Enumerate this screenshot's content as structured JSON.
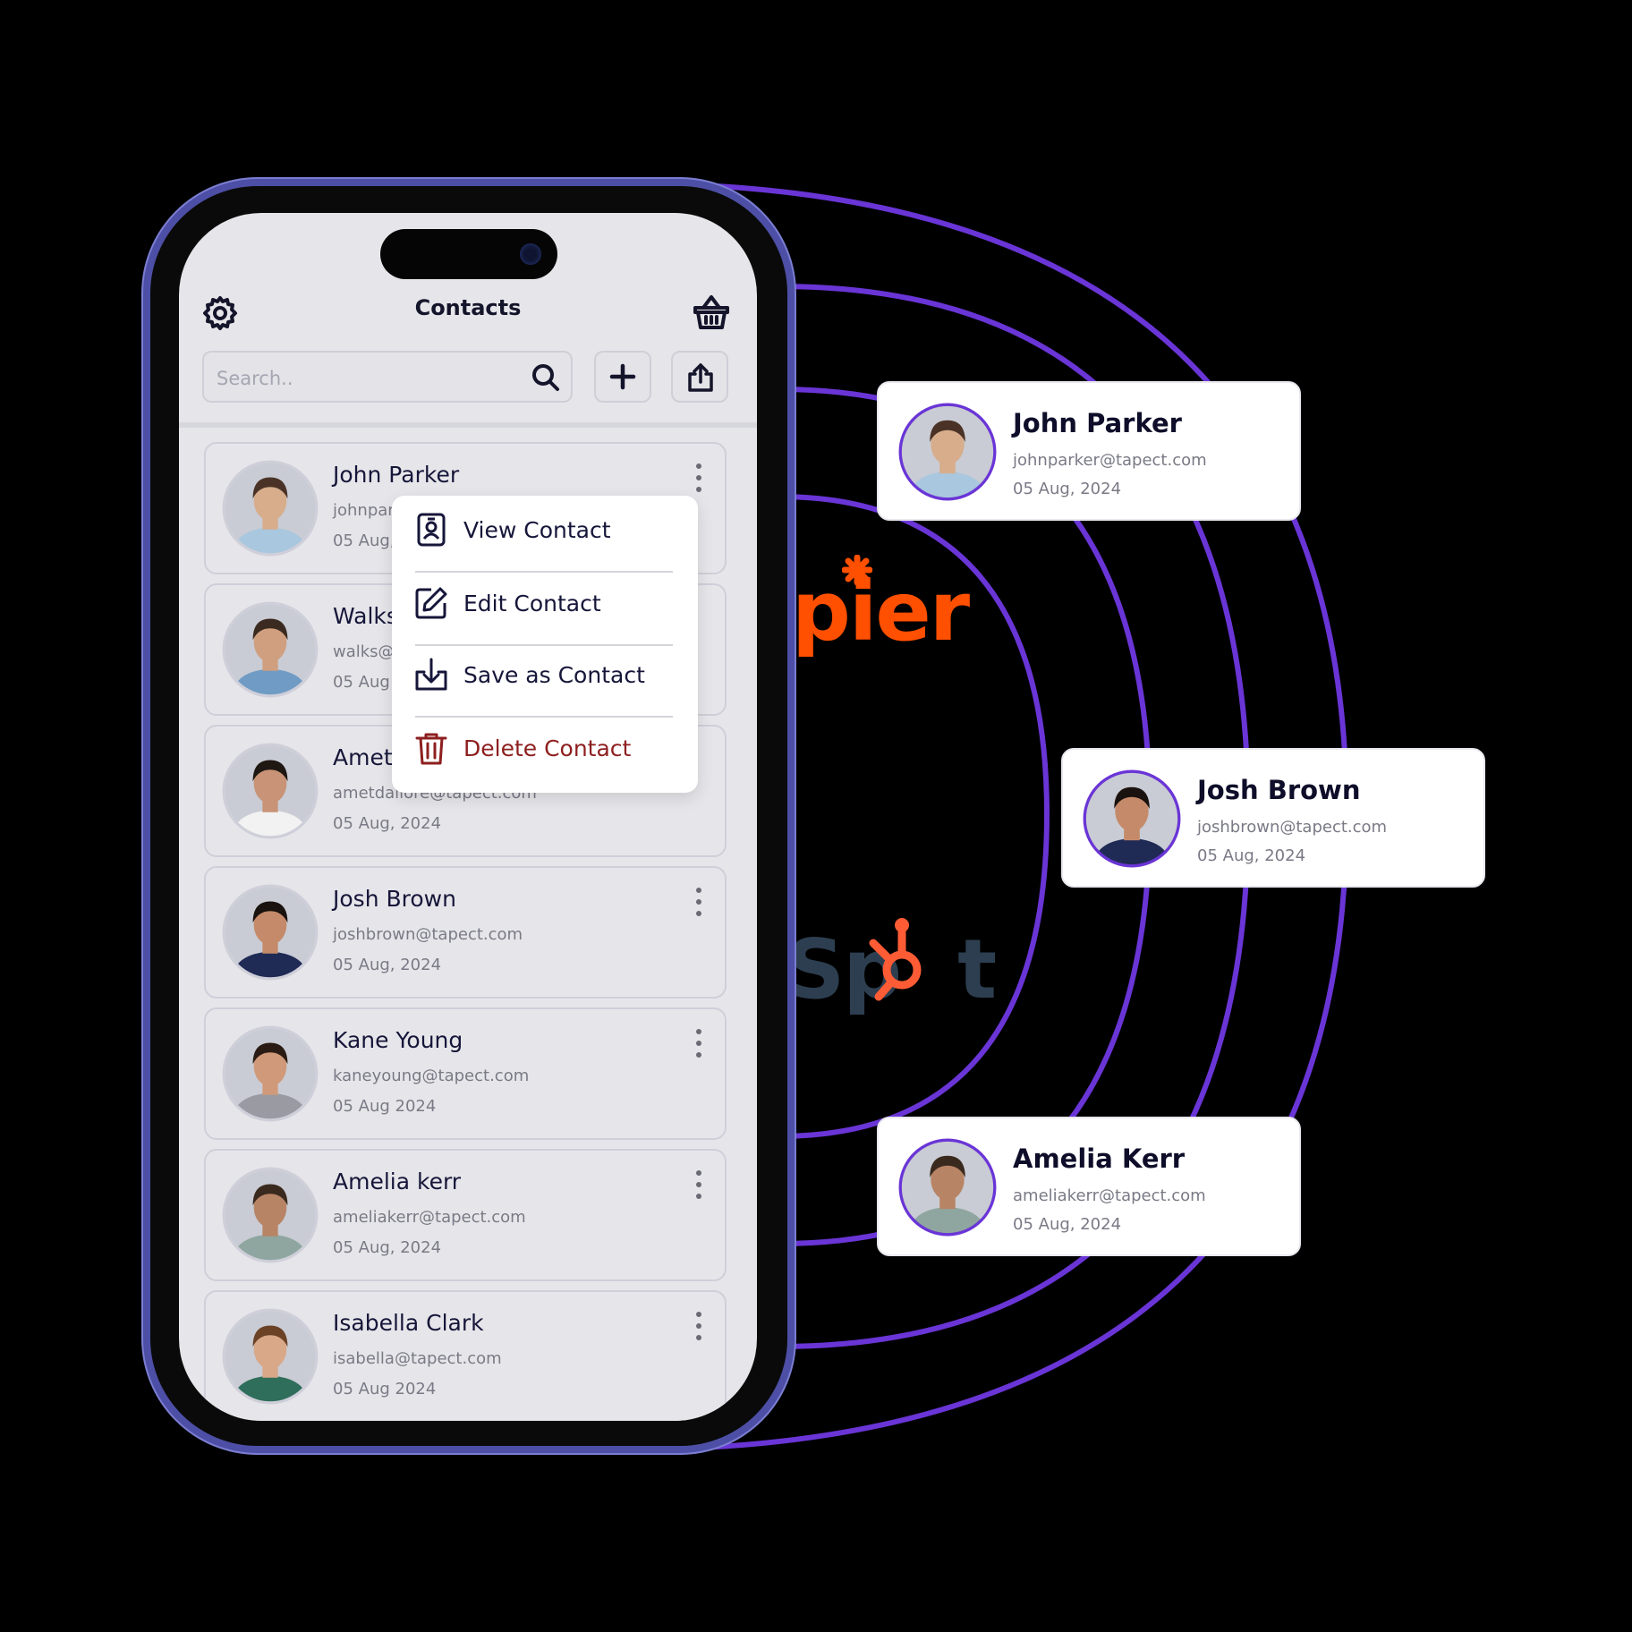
{
  "header": {
    "title": "Contacts"
  },
  "search": {
    "placeholder": "Search.."
  },
  "contacts": [
    {
      "name": "John Parker",
      "email": "johnpar",
      "date": "05 Aug,",
      "skin": "#d7ad8c",
      "hair": "#4a3326",
      "shirt": "#a9c7de"
    },
    {
      "name": "Walks",
      "email": "walks@",
      "date": "05 Aug",
      "skin": "#cf9f7f",
      "hair": "#3b2a20",
      "shirt": "#6f9bc4"
    },
    {
      "name": "Amet",
      "email": "ametdaliore@tapect.com",
      "date": "05 Aug, 2024",
      "skin": "#c89376",
      "hair": "#1f1712",
      "shirt": "#f2f2f2"
    },
    {
      "name": "Josh Brown",
      "email": "joshbrown@tapect.com",
      "date": "05 Aug, 2024",
      "skin": "#c58a69",
      "hair": "#1a120e",
      "shirt": "#1f2a55"
    },
    {
      "name": "Kane Young",
      "email": "kaneyoung@tapect.com",
      "date": "05 Aug 2024",
      "skin": "#d09a7a",
      "hair": "#2a1c14",
      "shirt": "#9a9aa2"
    },
    {
      "name": "Amelia kerr",
      "email": "ameliakerr@tapect.com",
      "date": "05 Aug, 2024",
      "skin": "#b88466",
      "hair": "#3a2a1e",
      "shirt": "#8fa6a0"
    },
    {
      "name": "Isabella Clark",
      "email": "isabella@tapect.com",
      "date": "05 Aug 2024",
      "skin": "#d8a889",
      "hair": "#6b4226",
      "shirt": "#2f6e5a"
    }
  ],
  "menu": {
    "items": [
      {
        "label": "View Contact",
        "icon": "contact-card-icon"
      },
      {
        "label": "Edit Contact",
        "icon": "edit-icon"
      },
      {
        "label": "Save as Contact",
        "icon": "download-icon"
      },
      {
        "label": "Delete Contact",
        "icon": "trash-icon"
      }
    ]
  },
  "floating": [
    {
      "name": "John Parker",
      "email": "johnparker@tapect.com",
      "date": "05 Aug, 2024",
      "skin": "#d7ad8c",
      "hair": "#4a3326",
      "shirt": "#a9c7de"
    },
    {
      "name": "Josh Brown",
      "email": "joshbrown@tapect.com",
      "date": "05 Aug, 2024",
      "skin": "#c58a69",
      "hair": "#1a120e",
      "shirt": "#1f2a55"
    },
    {
      "name": "Amelia Kerr",
      "email": "ameliakerr@tapect.com",
      "date": "05 Aug, 2024",
      "skin": "#b88466",
      "hair": "#3a2a1e",
      "shirt": "#8fa6a0"
    }
  ],
  "brands": {
    "zapier": "pier",
    "hubspot_a": "Sp",
    "hubspot_b": "t"
  },
  "colors": {
    "accent": "#6a35d6",
    "phone_edge": "#4d4fa6",
    "zapier": "#ff4f00",
    "hubspot_orange": "#ff5c35",
    "hubspot_navy": "#2d3e50",
    "danger": "#8e1f1f"
  }
}
